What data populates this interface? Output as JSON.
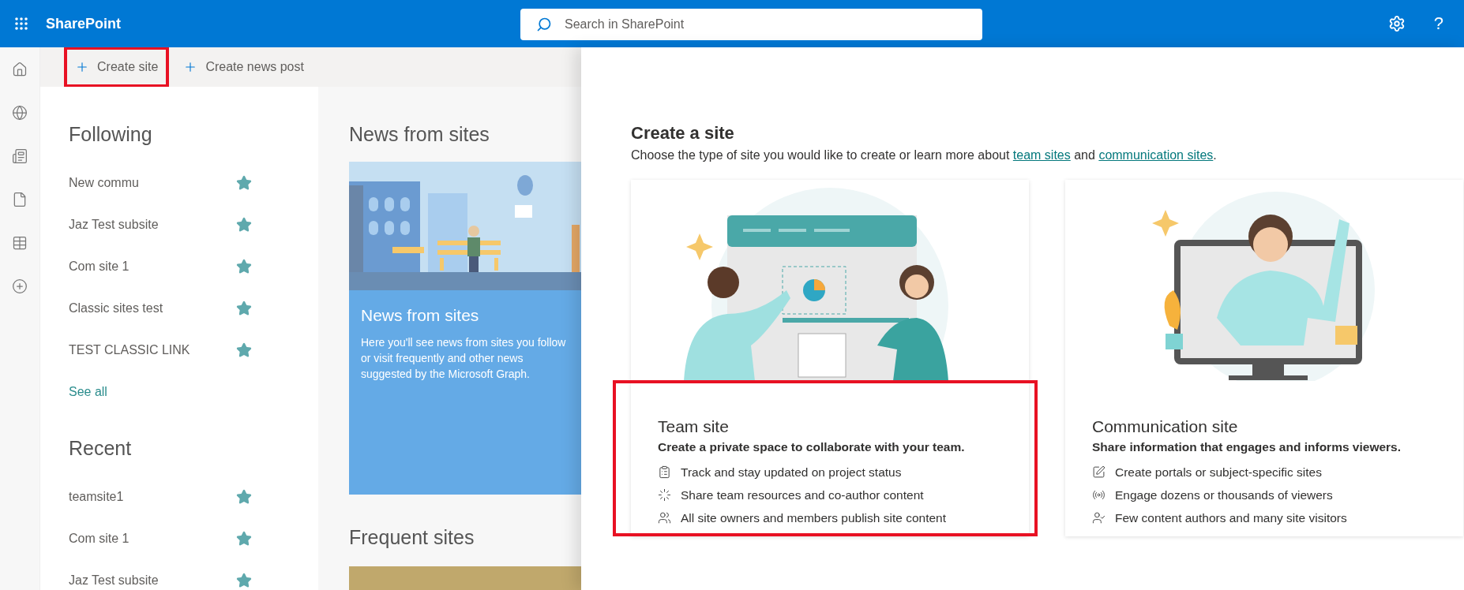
{
  "app": {
    "title": "SharePoint",
    "help": "?"
  },
  "search": {
    "placeholder": "Search in SharePoint"
  },
  "commands": [
    {
      "label": "Create site",
      "highlighted": true
    },
    {
      "label": "Create news post",
      "highlighted": false
    }
  ],
  "following": {
    "title": "Following",
    "items": [
      {
        "name": "New commu",
        "followed": true
      },
      {
        "name": "Jaz Test subsite",
        "followed": true
      },
      {
        "name": "Com site 1",
        "followed": true
      },
      {
        "name": "Classic sites test",
        "followed": true
      },
      {
        "name": "TEST CLASSIC LINK",
        "followed": true
      }
    ],
    "see_all": "See all"
  },
  "recent": {
    "title": "Recent",
    "items": [
      {
        "name": "teamsite1",
        "followed": true
      },
      {
        "name": "Com site 1",
        "followed": true
      },
      {
        "name": "Jaz Test subsite",
        "followed": true
      }
    ]
  },
  "news": {
    "heading": "News from sites",
    "card": {
      "title": "News from sites",
      "text": "Here you'll see news from sites you follow or visit frequently and other news suggested by the Microsoft Graph."
    }
  },
  "frequent": {
    "heading": "Frequent sites"
  },
  "create_panel": {
    "title": "Create a site",
    "description": {
      "lead": "Choose the type of site you would like to create or learn more about",
      "links": [
        "team sites",
        "communication sites"
      ],
      "joiner": "and",
      "end": "."
    },
    "site_types": [
      {
        "kind": "team",
        "title": "Team site",
        "subtitle": "Create a private space to collaborate with your team.",
        "highlighted": true,
        "features": [
          "Track and stay updated on project status",
          "Share team resources and co-author content",
          "All site owners and members publish site content"
        ]
      },
      {
        "kind": "communication",
        "title": "Communication site",
        "subtitle": "Share information that engages and informs viewers.",
        "highlighted": false,
        "features": [
          "Create portals or subject-specific sites",
          "Engage dozens or thousands of viewers",
          "Few content authors and many site visitors"
        ]
      }
    ]
  }
}
